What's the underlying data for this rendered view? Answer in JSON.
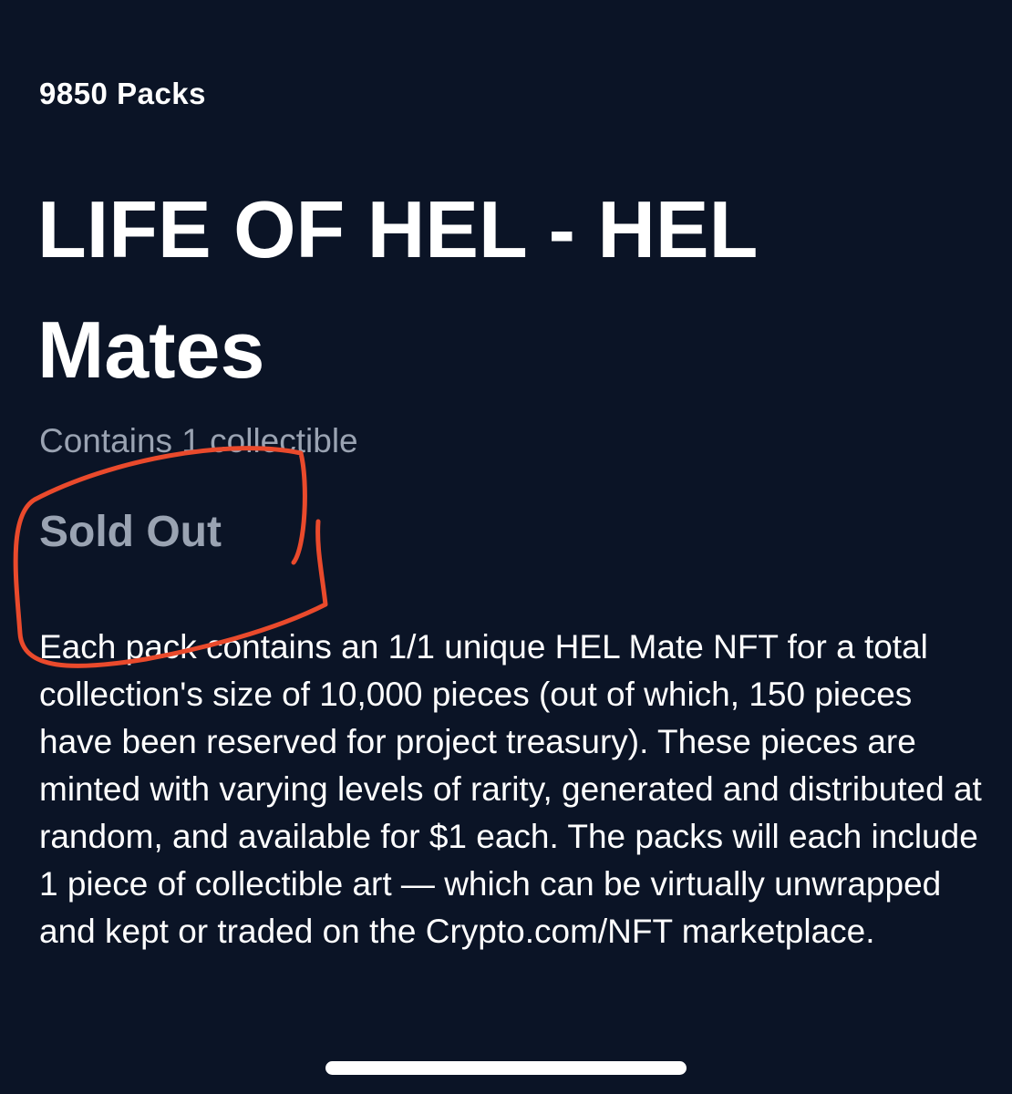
{
  "pack": {
    "count_label": "9850 Packs",
    "title": "LIFE OF HEL - HEL Mates",
    "contents": "Contains 1 collectible",
    "status": "Sold Out",
    "description": "Each pack contains an 1/1 unique HEL Mate NFT for a total collection's size of 10,000 pieces (out of which, 150 pieces have been reserved for project treasury). These pieces are minted with varying levels of rarity, generated and distributed at random, and available for $1 each. The packs will each include 1 piece of collectible art — which can be virtually unwrapped and kept or traded on the Crypto.com/NFT marketplace."
  },
  "colors": {
    "background": "#0b1426",
    "muted_text": "#9aa3b2",
    "annotation": "#ea4a2c"
  },
  "annotation": {
    "shape": "hand-drawn outline around sold-out status"
  }
}
